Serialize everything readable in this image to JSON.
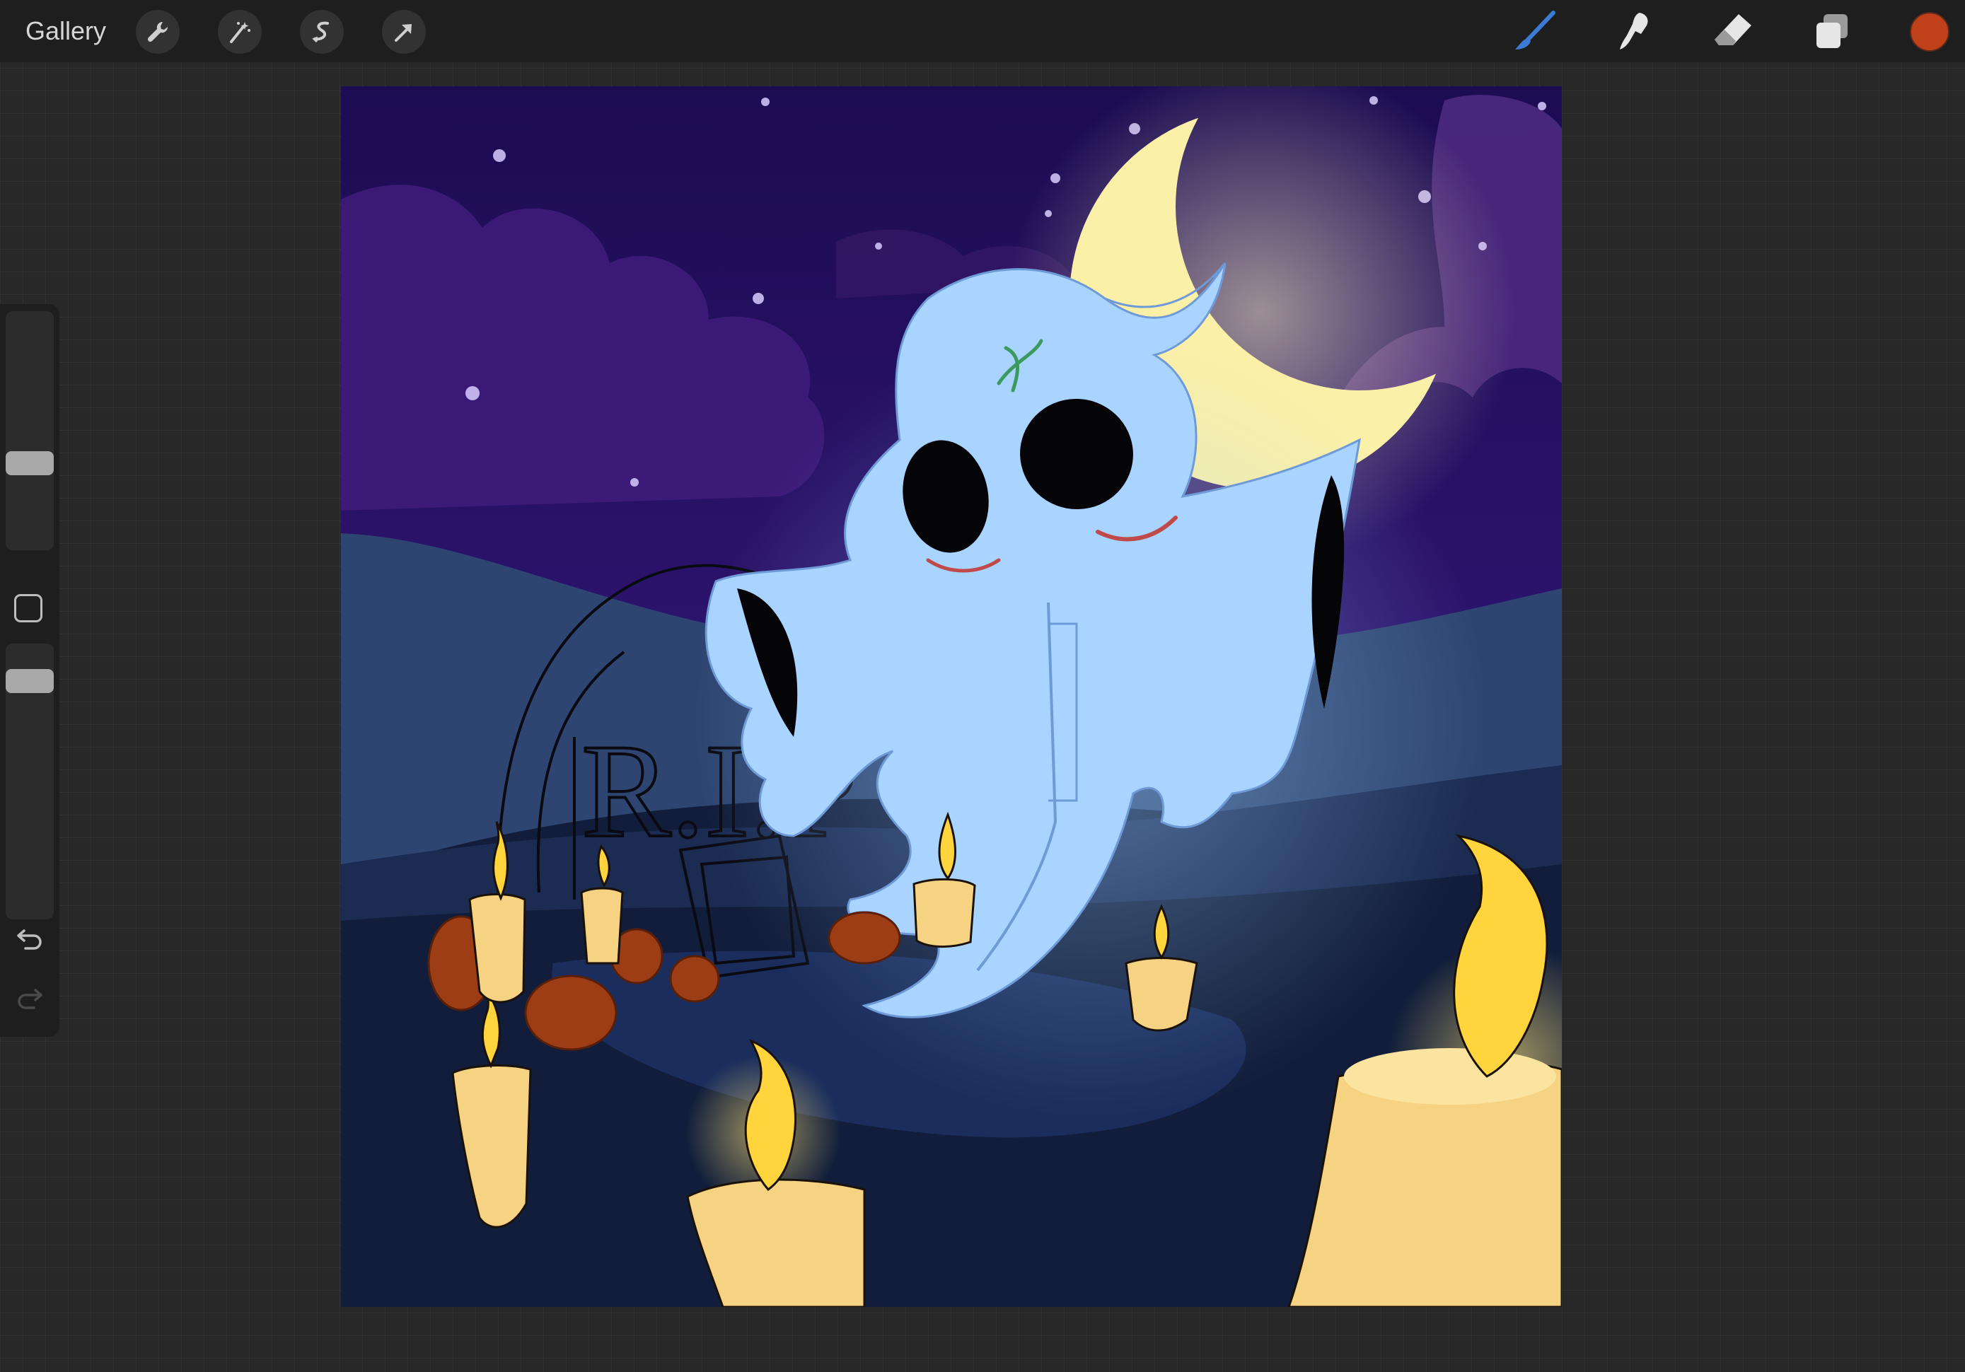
{
  "toolbar": {
    "gallery_label": "Gallery",
    "left_tools": [
      "wrench-icon",
      "magic-wand-icon",
      "selection-icon",
      "transform-arrow-icon"
    ],
    "right_tools": [
      "brush-icon",
      "smudge-icon",
      "eraser-icon",
      "layers-icon"
    ],
    "active_tool": "brush",
    "active_tool_color": "#3b7bd6",
    "current_color": "#c0401a"
  },
  "sidebar": {
    "brush_size_level": 0.35,
    "opacity_level": 0.1,
    "buttons": [
      "modify-square-icon",
      "undo-icon",
      "redo-icon"
    ],
    "redo_enabled": false
  },
  "canvas": {
    "tombstone_text": "R.I.P",
    "colors": {
      "sky_top": "#24105e",
      "sky_bottom": "#4a2a8a",
      "moon": "#fbf0a8",
      "ghost": "#a8d4ff",
      "ground": "#0f1a33",
      "hill": "#2e4571",
      "candle": "#f6d382",
      "flame": "#ffd43c",
      "marigold": "#9c3d16"
    }
  }
}
